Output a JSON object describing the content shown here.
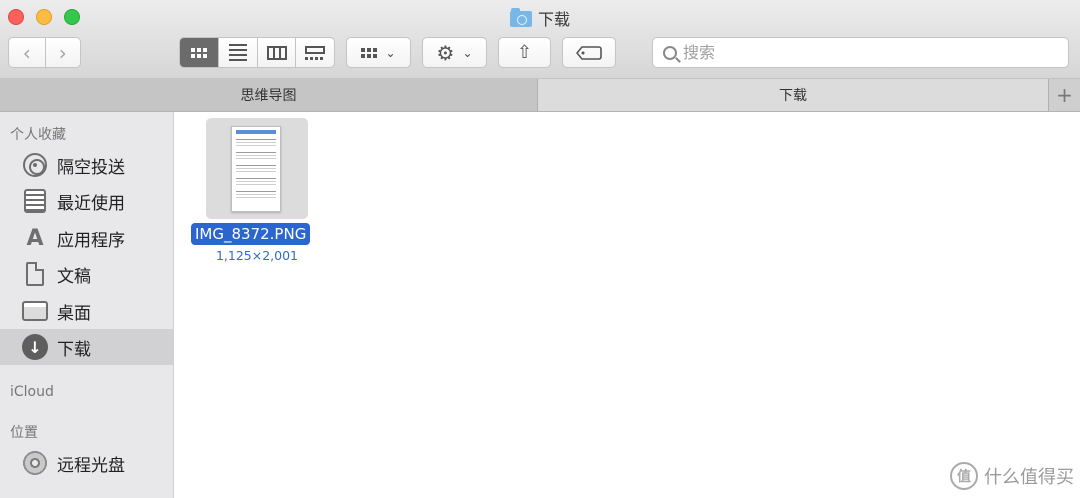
{
  "window": {
    "title": "下载"
  },
  "toolbar": {
    "back_glyph": "‹",
    "forward_glyph": "›",
    "share_glyph": "⇧",
    "chevron_glyph": "⌄"
  },
  "search": {
    "placeholder": "搜索"
  },
  "tabs": [
    {
      "label": "思维导图",
      "active": false
    },
    {
      "label": "下载",
      "active": true
    }
  ],
  "tab_add_glyph": "+",
  "sidebar": {
    "favorites_header": "个人收藏",
    "favorites": [
      {
        "label": "隔空投送",
        "icon": "airdrop-icon"
      },
      {
        "label": "最近使用",
        "icon": "recents-icon"
      },
      {
        "label": "应用程序",
        "icon": "applications-icon"
      },
      {
        "label": "文稿",
        "icon": "documents-icon"
      },
      {
        "label": "桌面",
        "icon": "desktop-icon"
      },
      {
        "label": "下载",
        "icon": "download-icon",
        "selected": true
      }
    ],
    "icloud_header": "iCloud",
    "locations_header": "位置",
    "locations": [
      {
        "label": "远程光盘",
        "icon": "disc-icon"
      }
    ]
  },
  "file": {
    "name": "IMG_8372.PNG",
    "dimensions": "1,125×2,001"
  },
  "watermark": {
    "logo_glyph": "值",
    "text": "什么值得买"
  },
  "colors": {
    "selection": "#2b66cf",
    "dimension_text": "#2f6bd4",
    "sidebar_bg": "#e8e8ea"
  }
}
